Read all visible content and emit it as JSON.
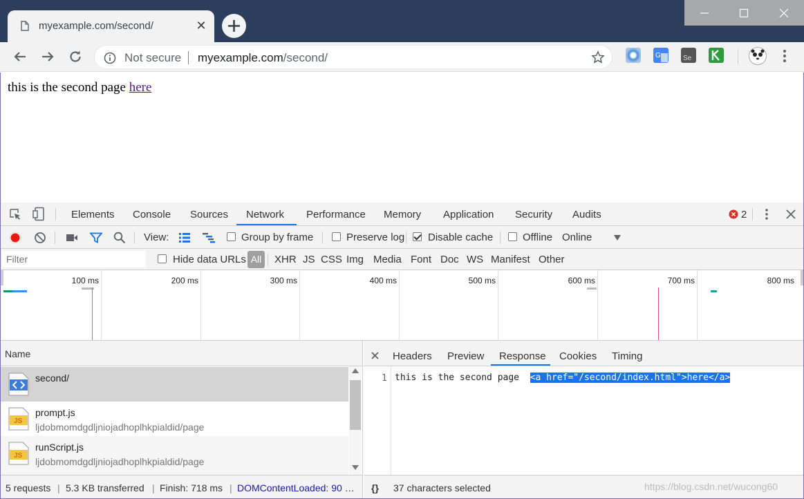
{
  "browser": {
    "tab_title": "myexample.com/second/",
    "not_secure": "Not secure",
    "url_host": "myexample.com",
    "url_path": "/second/"
  },
  "page": {
    "text": "this is the second page",
    "link_text": "here"
  },
  "devtools": {
    "tabs": [
      "Elements",
      "Console",
      "Sources",
      "Network",
      "Performance",
      "Memory",
      "Application",
      "Security",
      "Audits"
    ],
    "active_tab": "Network",
    "error_count": "2",
    "toolbar": {
      "view_label": "View:",
      "group_by_frame": "Group by frame",
      "preserve_log": "Preserve log",
      "disable_cache": "Disable cache",
      "offline": "Offline",
      "throttle": "Online"
    },
    "filter": {
      "placeholder": "Filter",
      "hide_data_urls": "Hide data URLs",
      "types": [
        "All",
        "XHR",
        "JS",
        "CSS",
        "Img",
        "Media",
        "Font",
        "Doc",
        "WS",
        "Manifest",
        "Other"
      ]
    },
    "timeline_ticks": [
      "100 ms",
      "200 ms",
      "300 ms",
      "400 ms",
      "500 ms",
      "600 ms",
      "700 ms",
      "800 ms"
    ],
    "name_header": "Name",
    "requests": [
      {
        "name": "second/",
        "sub": ""
      },
      {
        "name": "prompt.js",
        "sub": "ljdobmomdgdljniojadhoplhkpialdid/page"
      },
      {
        "name": "runScript.js",
        "sub": "ljdobmomdgdljniojadhoplhkpialdid/page"
      }
    ],
    "detail_tabs": [
      "Headers",
      "Preview",
      "Response",
      "Cookies",
      "Timing"
    ],
    "active_detail_tab": "Response",
    "response": {
      "line_no": "1",
      "plain": "this is the second page  ",
      "selected": "<a href=\"/second/index.html\">here</a>"
    },
    "status": {
      "requests": "5 requests",
      "transferred": "5.3 KB transferred",
      "finish": "Finish: 718 ms",
      "dom_loaded": "DOMContentLoaded: 90 …",
      "selection": "37 characters selected",
      "format_icon": "{}"
    }
  },
  "watermark": "https://blog.csdn.net/wucong60"
}
